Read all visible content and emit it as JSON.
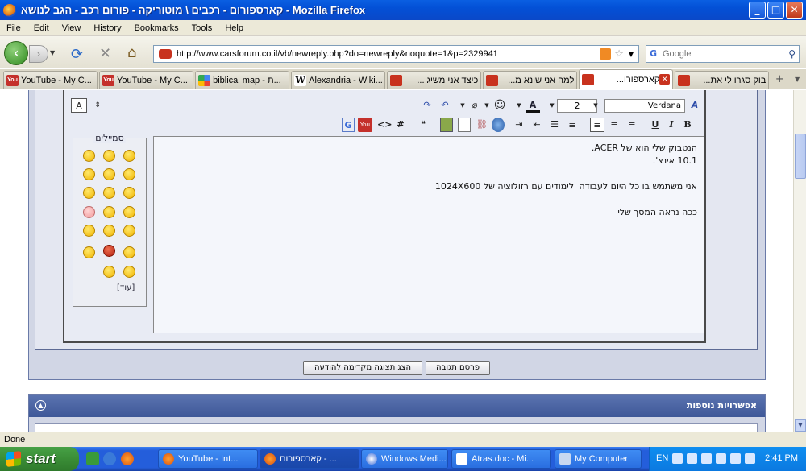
{
  "window": {
    "title": "קארספורום - רכבים \\ מוטוריקה - פורום רכב - הגב לנושא - Mozilla Firefox",
    "controls": {
      "minimize": "_",
      "maximize": "□",
      "close": "✕"
    }
  },
  "menu": [
    "File",
    "Edit",
    "View",
    "History",
    "Bookmarks",
    "Tools",
    "Help"
  ],
  "nav": {
    "url": "http://www.carsforum.co.il/vb/newreply.php?do=newreply&noquote=1&p=2329941",
    "search_placeholder": "Google"
  },
  "tabs": [
    {
      "label": "YouTube - My C...",
      "icon": "youtube-icon",
      "active": false
    },
    {
      "label": "YouTube - My C...",
      "icon": "youtube-icon",
      "active": false
    },
    {
      "label": "biblical map - ת...",
      "icon": "google-icon",
      "active": false
    },
    {
      "label": "Alexandria - Wiki...",
      "icon": "wikipedia-icon",
      "active": false
    },
    {
      "label": "כיצד אני משיג ...",
      "icon": "carsforum-icon",
      "active": false
    },
    {
      "label": "למה אני שונא מ...",
      "icon": "carsforum-icon",
      "active": false
    },
    {
      "label": "קארספורו...",
      "icon": "carsforum-icon",
      "active": true
    },
    {
      "label": "בוק סגרו לי את...",
      "icon": "carsforum-icon",
      "active": false
    }
  ],
  "editor": {
    "font_size": "2",
    "font_name": "Verdana",
    "smilies_title": "סמיילים",
    "smilies_more": "[עוד]",
    "text_lines": [
      "הנטבוק שלי הוא של ACER.",
      "10.1 אינצ'.",
      "",
      "אני משתמש בו כל היום לעבודה ולימודים עם רזולוציה של 1024X600",
      "",
      "ככה נראה המסך שלי"
    ]
  },
  "buttons": {
    "submit": "פרסם תגובה",
    "preview": "הצג תצוגה מקדימה להודעה"
  },
  "options_panel": {
    "title": "אפשרויות נוספות"
  },
  "status": "Done",
  "taskbar": {
    "start_label": "start",
    "tasks": [
      {
        "label": "YouTube - Int..."
      },
      {
        "label": "קארספורום - ..."
      },
      {
        "label": "Windows Medi..."
      },
      {
        "label": "Atras.doc - Mi..."
      },
      {
        "label": "My Computer"
      }
    ],
    "lang": "EN",
    "clock": "2:41 PM"
  },
  "colors": {
    "titlebar": "#0350d6",
    "forum_accent": "#3e5898",
    "tab_site": "#c8321e"
  }
}
